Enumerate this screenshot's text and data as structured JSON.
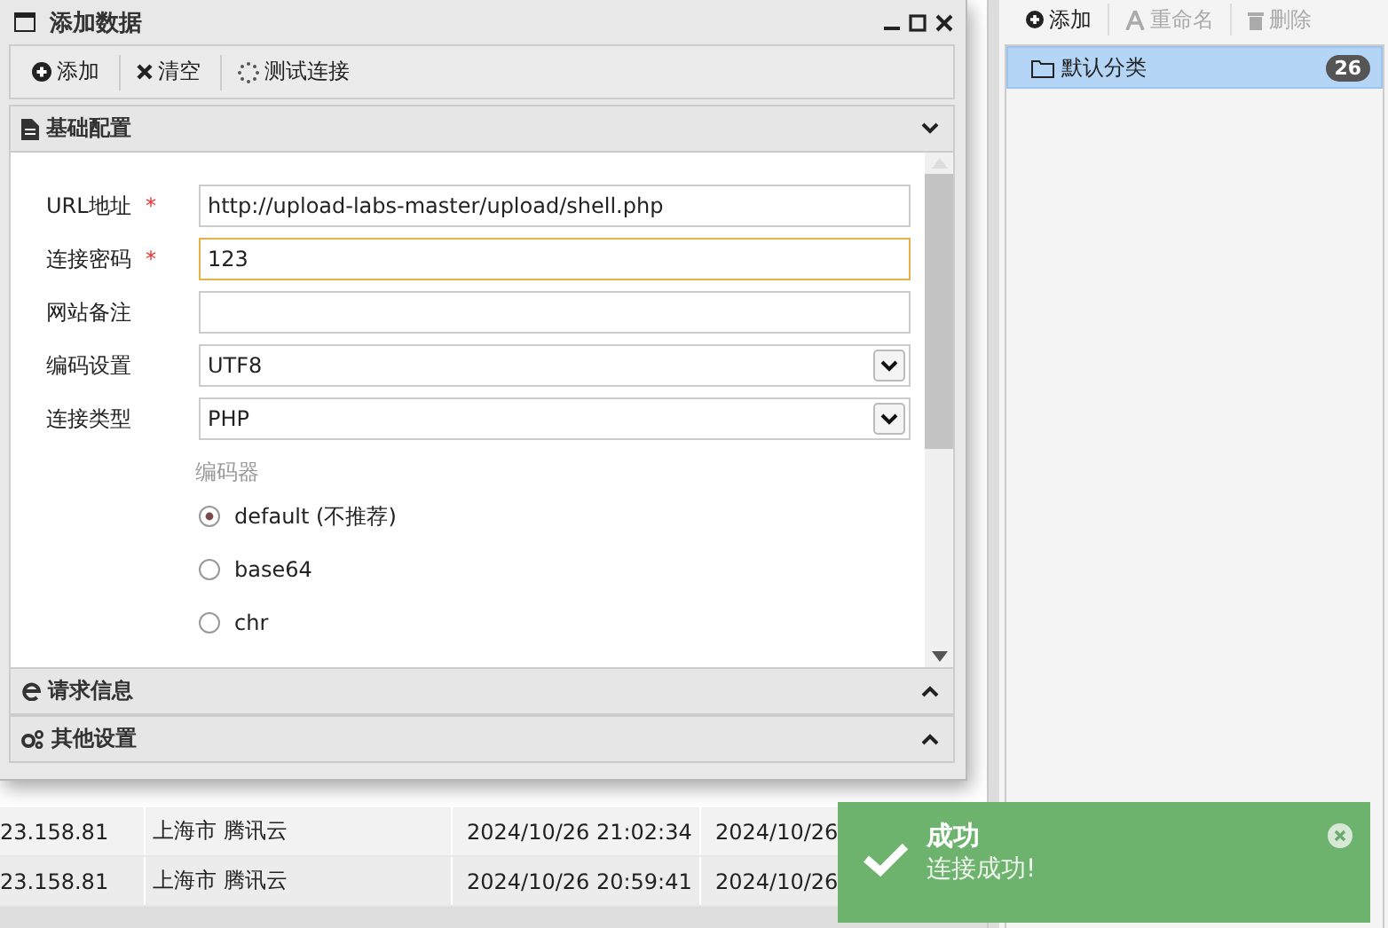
{
  "dialog": {
    "title": "添加数据",
    "toolbar": [
      {
        "label": "添加"
      },
      {
        "label": "清空"
      },
      {
        "label": "测试连接"
      }
    ],
    "sections": [
      {
        "title": "基础配置",
        "expanded": true
      },
      {
        "title": "请求信息",
        "expanded": false
      },
      {
        "title": "其他设置",
        "expanded": false
      }
    ],
    "fields": [
      {
        "label": "URL地址",
        "marker": "*",
        "kind": "text",
        "value": "http://upload-labs-master/upload/shell.php",
        "focused": false
      },
      {
        "label": "连接密码",
        "marker": "*",
        "kind": "text",
        "value": "123",
        "focused": true
      },
      {
        "label": "网站备注",
        "kind": "text",
        "focused": false
      },
      {
        "label": "编码设置",
        "kind": "select",
        "value": "UTF8",
        "focused": false
      },
      {
        "label": "连接类型",
        "kind": "select",
        "value": "PHP",
        "focused": false
      }
    ],
    "encoder": {
      "title": "编码器",
      "options": [
        {
          "label": "default (不推荐)",
          "selected": true
        },
        {
          "label": "base64",
          "selected": false
        },
        {
          "label": "chr",
          "selected": false
        }
      ]
    }
  },
  "category_toolbar": [
    {
      "label": "添加",
      "disabled": false
    },
    {
      "label": "重命名",
      "disabled": true
    },
    {
      "label": "删除",
      "disabled": true
    }
  ],
  "categories": [
    {
      "label": "默认分类",
      "count": "26",
      "selected": true
    }
  ],
  "table": {
    "rows": [
      {
        "cells": [
          "23.158.81",
          "上海市 腾讯云",
          "2024/10/26 21:02:34",
          "2024/10/26"
        ]
      },
      {
        "cells": [
          "23.158.81",
          "上海市 腾讯云",
          "2024/10/26 20:59:41",
          "2024/10/26"
        ]
      }
    ]
  },
  "toast": {
    "title": "成功",
    "message": "连接成功!"
  }
}
